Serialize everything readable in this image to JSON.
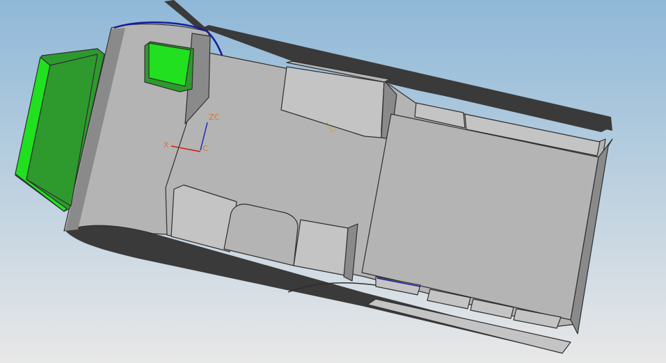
{
  "viewport": {
    "background_top": "#8fb8d8",
    "background_bottom": "#e8e8e8",
    "model_colors": {
      "body": "#b4b4b4",
      "body_light": "#c4c4c4",
      "body_dark": "#8a8a8a",
      "edge": "#2e2e2e",
      "shadow": "#3a3a3a",
      "green_main": "#20e020",
      "green_dark": "#2e9a2e",
      "selection_edge": "#1a1a9a"
    }
  },
  "triad": {
    "labels": {
      "z": "ZC",
      "x": "X",
      "y": "C"
    },
    "colors": {
      "z": "#1a2ab8",
      "x": "#e01010",
      "label": "#e07030"
    }
  }
}
